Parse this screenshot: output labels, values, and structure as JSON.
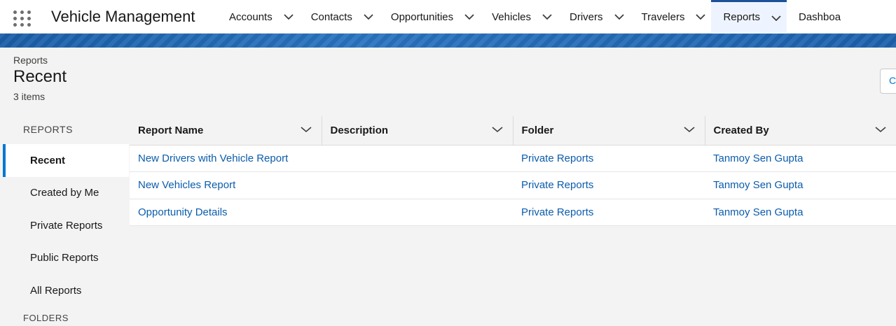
{
  "app": {
    "name": "Vehicle Management"
  },
  "nav": [
    {
      "label": "Accounts"
    },
    {
      "label": "Contacts"
    },
    {
      "label": "Opportunities"
    },
    {
      "label": "Vehicles"
    },
    {
      "label": "Drivers"
    },
    {
      "label": "Travelers"
    },
    {
      "label": "Reports",
      "active": true
    },
    {
      "label": "Dashboa"
    }
  ],
  "page": {
    "breadcrumb": "Reports",
    "title": "Recent",
    "count": "3 items",
    "header_button": "C"
  },
  "sidebar": {
    "heading": "REPORTS",
    "items": [
      {
        "label": "Recent",
        "active": true
      },
      {
        "label": "Created by Me"
      },
      {
        "label": "Private Reports"
      },
      {
        "label": "Public Reports"
      },
      {
        "label": "All Reports"
      }
    ],
    "folders_heading": "FOLDERS"
  },
  "table": {
    "columns": [
      "Report Name",
      "Description",
      "Folder",
      "Created By"
    ],
    "rows": [
      {
        "name": "New Drivers with Vehicle Report",
        "description": "",
        "folder": "Private Reports",
        "created_by": "Tanmoy Sen Gupta"
      },
      {
        "name": "New Vehicles Report",
        "description": "",
        "folder": "Private Reports",
        "created_by": "Tanmoy Sen Gupta"
      },
      {
        "name": "Opportunity Details",
        "description": "",
        "folder": "Private Reports",
        "created_by": "Tanmoy Sen Gupta"
      }
    ]
  },
  "colors": {
    "accent": "#0176d3",
    "link": "#0b5cab",
    "band": "#1d62ad"
  },
  "icons": {
    "app_launcher": "waffle-icon",
    "dropdown": "chevron-down-icon"
  }
}
